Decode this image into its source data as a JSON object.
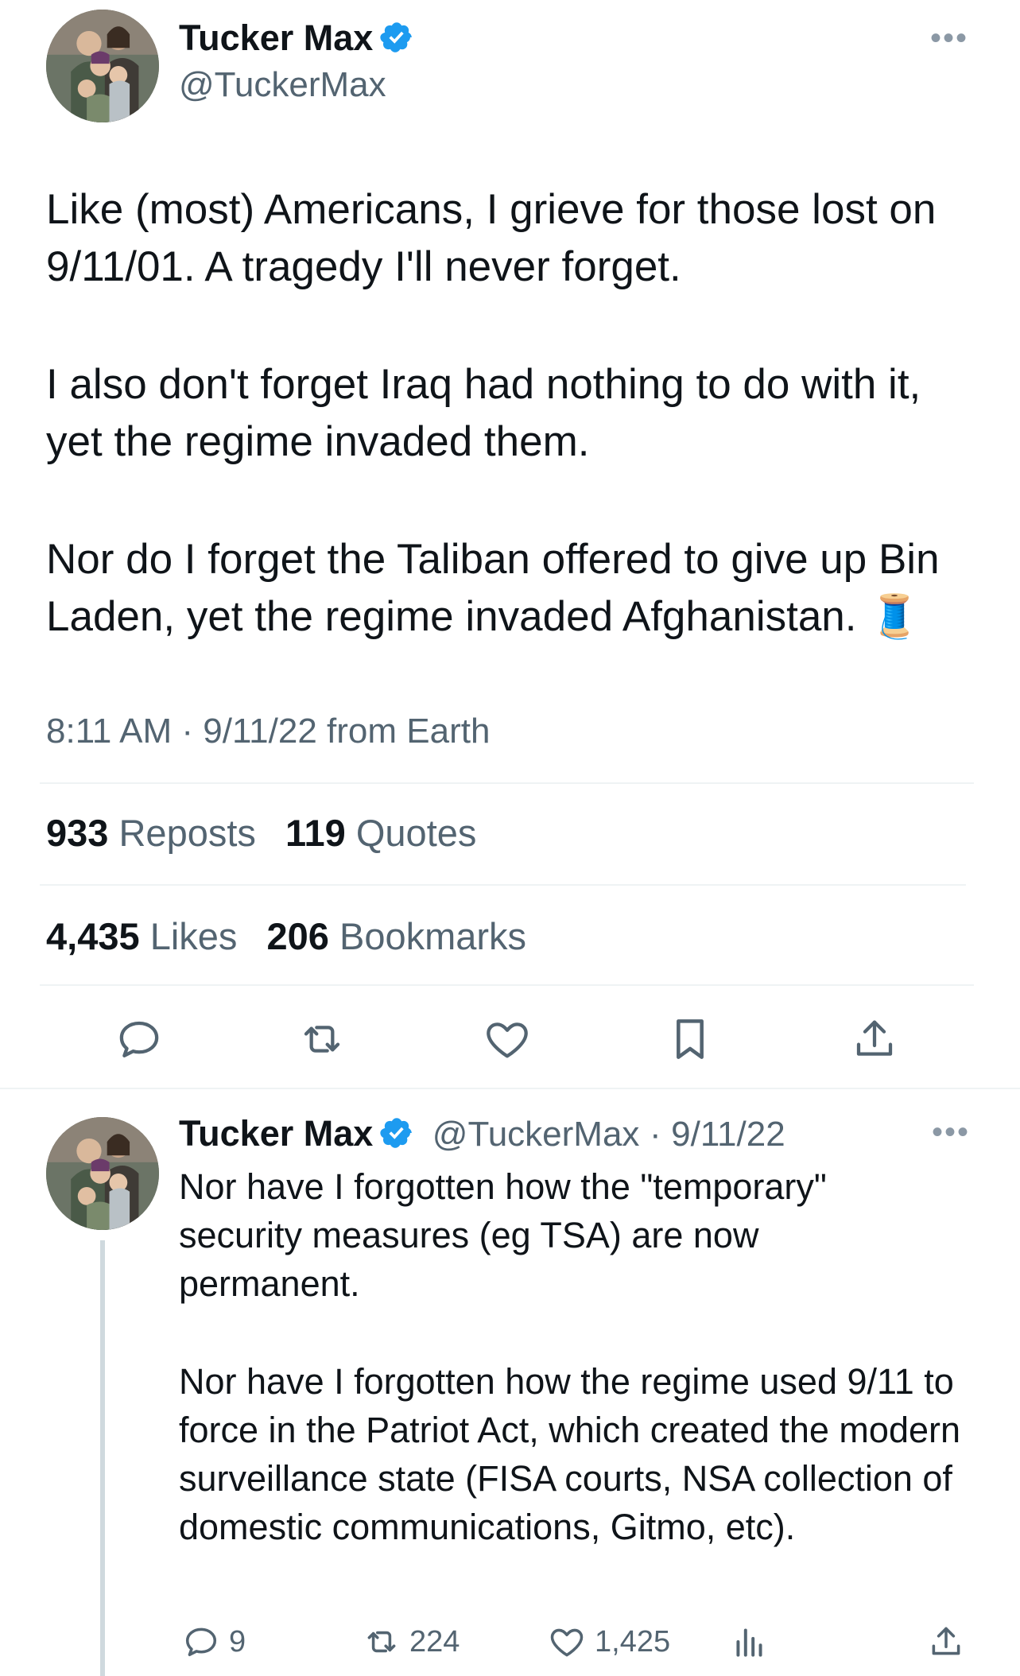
{
  "colors": {
    "accent": "#1d9bf0",
    "muted": "#536471",
    "text": "#0f1419"
  },
  "main_tweet": {
    "author_name": "Tucker Max",
    "author_handle": "@TuckerMax",
    "more_label": "•••",
    "paragraphs": [
      "Like (most) Americans, I grieve for those lost on 9/11/01. A tragedy I'll never forget.",
      "I also don't forget Iraq had nothing to do with it, yet the regime invaded them.",
      "Nor do I forget the Taliban offered to give up Bin Laden, yet the regime invaded Afghanistan."
    ],
    "emoji": "🧵",
    "timestamp": "8:11 AM · 9/11/22 from Earth",
    "stats": {
      "reposts_count": "933",
      "reposts_label": "Reposts",
      "quotes_count": "119",
      "quotes_label": "Quotes",
      "likes_count": "4,435",
      "likes_label": "Likes",
      "bookmarks_count": "206",
      "bookmarks_label": "Bookmarks"
    },
    "actions": [
      "reply-icon",
      "repost-icon",
      "like-icon",
      "bookmark-icon",
      "share-icon"
    ]
  },
  "reply_tweet": {
    "author_name": "Tucker Max",
    "author_handle": "@TuckerMax",
    "separator": "·",
    "date": "9/11/22",
    "more_label": "•••",
    "paragraphs": [
      "Nor have I forgotten how the \"temporary\" security measures (eg TSA) are now permanent.",
      "Nor have I forgotten how the regime used 9/11 to force in the Patriot Act, which created the modern surveillance state (FISA courts, NSA collection of domestic communications, Gitmo, etc)."
    ],
    "actions": {
      "replies": "9",
      "reposts": "224",
      "likes": "1,425",
      "views_icon": "views-icon",
      "share_icon": "share-icon"
    }
  }
}
